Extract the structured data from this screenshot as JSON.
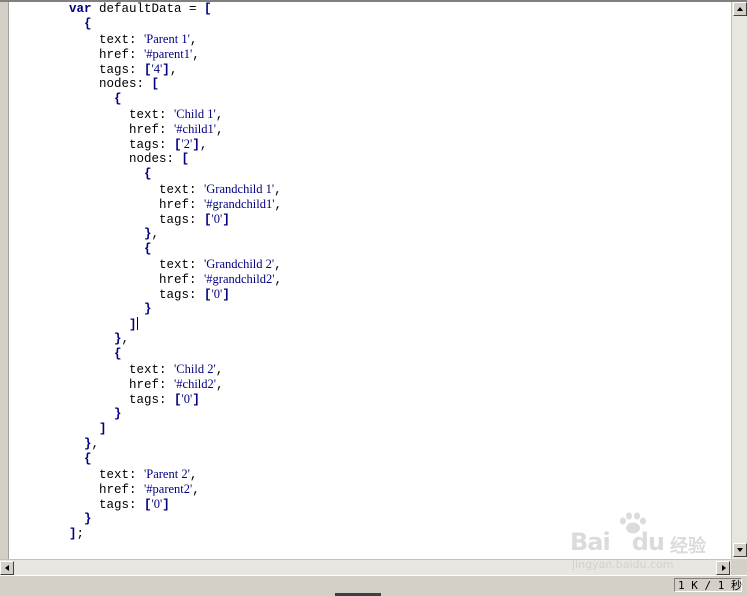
{
  "code_lines": [
    [
      {
        "t": "var",
        "c": "kw"
      },
      {
        "t": " defaultData = ",
        "c": "tx"
      },
      {
        "t": "[",
        "c": "pn"
      }
    ],
    [
      {
        "t": "  ",
        "c": "tx"
      },
      {
        "t": "{",
        "c": "pn"
      }
    ],
    [
      {
        "t": "    text: ",
        "c": "tx"
      },
      {
        "t": "'Parent 1'",
        "c": "st"
      },
      {
        "t": ",",
        "c": "tx"
      }
    ],
    [
      {
        "t": "    href: ",
        "c": "tx"
      },
      {
        "t": "'#parent1'",
        "c": "st"
      },
      {
        "t": ",",
        "c": "tx"
      }
    ],
    [
      {
        "t": "    tags: ",
        "c": "tx"
      },
      {
        "t": "[",
        "c": "pn"
      },
      {
        "t": "'4'",
        "c": "st"
      },
      {
        "t": "]",
        "c": "pn"
      },
      {
        "t": ",",
        "c": "tx"
      }
    ],
    [
      {
        "t": "    nodes: ",
        "c": "tx"
      },
      {
        "t": "[",
        "c": "pn"
      }
    ],
    [
      {
        "t": "      ",
        "c": "tx"
      },
      {
        "t": "{",
        "c": "pn"
      }
    ],
    [
      {
        "t": "        text: ",
        "c": "tx"
      },
      {
        "t": "'Child 1'",
        "c": "st"
      },
      {
        "t": ",",
        "c": "tx"
      }
    ],
    [
      {
        "t": "        href: ",
        "c": "tx"
      },
      {
        "t": "'#child1'",
        "c": "st"
      },
      {
        "t": ",",
        "c": "tx"
      }
    ],
    [
      {
        "t": "        tags: ",
        "c": "tx"
      },
      {
        "t": "[",
        "c": "pn"
      },
      {
        "t": "'2'",
        "c": "st"
      },
      {
        "t": "]",
        "c": "pn"
      },
      {
        "t": ",",
        "c": "tx"
      }
    ],
    [
      {
        "t": "        nodes: ",
        "c": "tx"
      },
      {
        "t": "[",
        "c": "pn"
      }
    ],
    [
      {
        "t": "          ",
        "c": "tx"
      },
      {
        "t": "{",
        "c": "pn"
      }
    ],
    [
      {
        "t": "            text: ",
        "c": "tx"
      },
      {
        "t": "'Grandchild 1'",
        "c": "st"
      },
      {
        "t": ",",
        "c": "tx"
      }
    ],
    [
      {
        "t": "            href: ",
        "c": "tx"
      },
      {
        "t": "'#grandchild1'",
        "c": "st"
      },
      {
        "t": ",",
        "c": "tx"
      }
    ],
    [
      {
        "t": "            tags: ",
        "c": "tx"
      },
      {
        "t": "[",
        "c": "pn"
      },
      {
        "t": "'0'",
        "c": "st"
      },
      {
        "t": "]",
        "c": "pn"
      }
    ],
    [
      {
        "t": "          ",
        "c": "tx"
      },
      {
        "t": "}",
        "c": "pn"
      },
      {
        "t": ",",
        "c": "tx"
      }
    ],
    [
      {
        "t": "          ",
        "c": "tx"
      },
      {
        "t": "{",
        "c": "pn"
      }
    ],
    [
      {
        "t": "            text: ",
        "c": "tx"
      },
      {
        "t": "'Grandchild 2'",
        "c": "st"
      },
      {
        "t": ",",
        "c": "tx"
      }
    ],
    [
      {
        "t": "            href: ",
        "c": "tx"
      },
      {
        "t": "'#grandchild2'",
        "c": "st"
      },
      {
        "t": ",",
        "c": "tx"
      }
    ],
    [
      {
        "t": "            tags: ",
        "c": "tx"
      },
      {
        "t": "[",
        "c": "pn"
      },
      {
        "t": "'0'",
        "c": "st"
      },
      {
        "t": "]",
        "c": "pn"
      }
    ],
    [
      {
        "t": "          ",
        "c": "tx"
      },
      {
        "t": "}",
        "c": "pn"
      }
    ],
    [
      {
        "t": "        ",
        "c": "tx"
      },
      {
        "t": "]",
        "c": "pn"
      },
      {
        "t": "",
        "c": "caret"
      }
    ],
    [
      {
        "t": "      ",
        "c": "tx"
      },
      {
        "t": "}",
        "c": "pn"
      },
      {
        "t": ",",
        "c": "tx"
      }
    ],
    [
      {
        "t": "      ",
        "c": "tx"
      },
      {
        "t": "{",
        "c": "pn"
      }
    ],
    [
      {
        "t": "        text: ",
        "c": "tx"
      },
      {
        "t": "'Child 2'",
        "c": "st"
      },
      {
        "t": ",",
        "c": "tx"
      }
    ],
    [
      {
        "t": "        href: ",
        "c": "tx"
      },
      {
        "t": "'#child2'",
        "c": "st"
      },
      {
        "t": ",",
        "c": "tx"
      }
    ],
    [
      {
        "t": "        tags: ",
        "c": "tx"
      },
      {
        "t": "[",
        "c": "pn"
      },
      {
        "t": "'0'",
        "c": "st"
      },
      {
        "t": "]",
        "c": "pn"
      }
    ],
    [
      {
        "t": "      ",
        "c": "tx"
      },
      {
        "t": "}",
        "c": "pn"
      }
    ],
    [
      {
        "t": "    ",
        "c": "tx"
      },
      {
        "t": "]",
        "c": "pn"
      }
    ],
    [
      {
        "t": "  ",
        "c": "tx"
      },
      {
        "t": "}",
        "c": "pn"
      },
      {
        "t": ",",
        "c": "tx"
      }
    ],
    [
      {
        "t": "  ",
        "c": "tx"
      },
      {
        "t": "{",
        "c": "pn"
      }
    ],
    [
      {
        "t": "    text: ",
        "c": "tx"
      },
      {
        "t": "'Parent 2'",
        "c": "st"
      },
      {
        "t": ",",
        "c": "tx"
      }
    ],
    [
      {
        "t": "    href: ",
        "c": "tx"
      },
      {
        "t": "'#parent2'",
        "c": "st"
      },
      {
        "t": ",",
        "c": "tx"
      }
    ],
    [
      {
        "t": "    tags: ",
        "c": "tx"
      },
      {
        "t": "[",
        "c": "pn"
      },
      {
        "t": "'0'",
        "c": "st"
      },
      {
        "t": "]",
        "c": "pn"
      }
    ],
    [
      {
        "t": "  ",
        "c": "tx"
      },
      {
        "t": "}",
        "c": "pn"
      }
    ],
    [
      {
        "t": "]",
        "c": "pn"
      },
      {
        "t": ";",
        "c": "tx"
      }
    ]
  ],
  "status": {
    "size_text": "1 K / 1 秒"
  },
  "watermark": {
    "logo_text": "Bai",
    "logo_text_2": "du",
    "cn_text": "经验",
    "url_text": "jingyan.baidu.com"
  },
  "icons": {
    "scroll_up": "arrow-up-icon",
    "scroll_down": "arrow-down-icon",
    "scroll_left": "arrow-left-icon",
    "scroll_right": "arrow-right-icon",
    "watermark_logo": "paw-icon"
  },
  "colors": {
    "keyword": "#000080",
    "string": "#000080",
    "editor_bg": "#ffffff",
    "chrome_bg": "#d4d0c8"
  }
}
